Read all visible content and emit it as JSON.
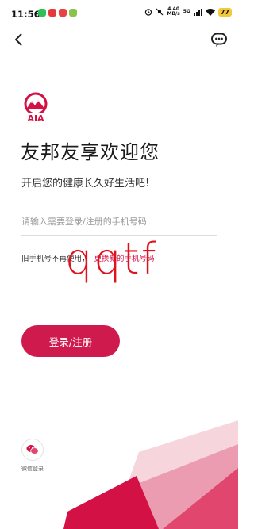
{
  "status_bar": {
    "time": "11:56",
    "net_speed_value": "4.40",
    "net_speed_unit": "MB/s",
    "network": "5G",
    "battery": "77"
  },
  "login": {
    "title": "友邦友享欢迎您",
    "subtitle": "开启您的健康长久好生活吧!",
    "phone_placeholder": "请输入需要登录/注册的手机号码",
    "old_phone_text": "旧手机号不再使用，",
    "change_phone_link": "更换新的手机号码",
    "submit_label": "登录/注册",
    "wechat_label": "微信登录"
  },
  "logo_text": "AIA",
  "watermark": "qqtf",
  "colors": {
    "brand": "#d31145",
    "button": "#cf1a4d",
    "watermark": "#e0101d"
  },
  "icons": {
    "back": "chevron-left-icon",
    "service": "chat-bubble-icon",
    "wechat": "wechat-icon"
  }
}
